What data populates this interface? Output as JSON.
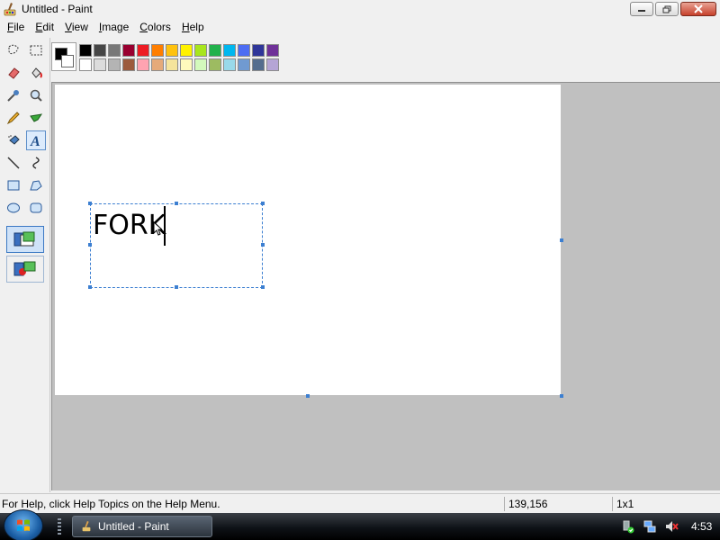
{
  "window": {
    "title": "Untitled - Paint",
    "minimize_icon": "minimize-icon",
    "maximize_icon": "restore-icon",
    "close_icon": "close-icon"
  },
  "menu": {
    "items": [
      {
        "label": "File"
      },
      {
        "label": "Edit"
      },
      {
        "label": "View"
      },
      {
        "label": "Image"
      },
      {
        "label": "Colors"
      },
      {
        "label": "Help"
      }
    ]
  },
  "toolbox": {
    "tools": [
      {
        "icon": "free-form-select-icon"
      },
      {
        "icon": "select-icon"
      },
      {
        "icon": "eraser-icon"
      },
      {
        "icon": "fill-bucket-icon"
      },
      {
        "icon": "color-picker-icon"
      },
      {
        "icon": "magnifier-icon"
      },
      {
        "icon": "pencil-icon"
      },
      {
        "icon": "brush-icon"
      },
      {
        "icon": "airbrush-icon"
      },
      {
        "icon": "text-tool-icon",
        "glyph": "A",
        "selected": true
      },
      {
        "icon": "line-icon"
      },
      {
        "icon": "curve-icon"
      },
      {
        "icon": "rectangle-icon"
      },
      {
        "icon": "polygon-icon"
      },
      {
        "icon": "ellipse-icon"
      },
      {
        "icon": "rounded-rectangle-icon"
      }
    ],
    "options": [
      {
        "icon": "opaque-background-icon",
        "selected": true
      },
      {
        "icon": "transparent-background-icon",
        "selected": false
      }
    ]
  },
  "colors": {
    "foreground": "#000000",
    "background": "#ffffff",
    "palette_row1": [
      "#000000",
      "#464646",
      "#787878",
      "#990030",
      "#ed1c24",
      "#ff7e00",
      "#ffc20e",
      "#fff200",
      "#a8e61d",
      "#22b14c",
      "#00b7ef",
      "#4d6df3",
      "#2f3699",
      "#6f3198"
    ],
    "palette_row2": [
      "#ffffff",
      "#dcdcdc",
      "#b4b4b4",
      "#9c5a3c",
      "#ffa3b1",
      "#e5aa7a",
      "#f5e49c",
      "#fff9bd",
      "#d3f9bc",
      "#9dbb61",
      "#99d9ea",
      "#709ad1",
      "#546d8e",
      "#b5a5d5"
    ]
  },
  "canvas": {
    "typed_text": "FORK"
  },
  "status": {
    "help_text": "For Help, click Help Topics on the Help Menu.",
    "coords": "139,156",
    "size": "1x1"
  },
  "taskbar": {
    "task_label": "Untitled - Paint",
    "clock": "4:53",
    "tray_icons": [
      "safely-remove-icon",
      "network-icon",
      "volume-muted-icon"
    ]
  }
}
